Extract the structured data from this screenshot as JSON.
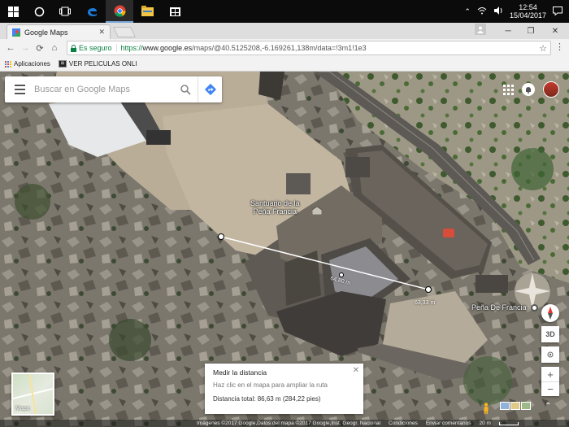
{
  "taskbar": {
    "icons": [
      "windows-start-icon",
      "search-icon",
      "task-view-icon",
      "edge-icon",
      "chrome-icon",
      "file-explorer-icon",
      "store-icon"
    ],
    "time": "12:54",
    "date": "15/04/2017"
  },
  "browser": {
    "tab_title": "Google Maps",
    "secure_label": "Es seguro",
    "url_prefix": "https://",
    "url_host": "www.google.es",
    "url_path": "/maps/@40.5125208,-6.169261,138m/data=!3m1!1e3",
    "bookmarks": [
      {
        "label": "Aplicaciones",
        "icon": "apps-icon"
      },
      {
        "label": "VER PELICULAS ONLI",
        "icon": "site-favicon"
      }
    ]
  },
  "maps": {
    "search_placeholder": "Buscar en Google Maps",
    "labels": {
      "sanctuary": "Santuario de la Peña Francia",
      "sanctuary_line1": "Santuario de la",
      "sanctuary_line2": "Peña Francia",
      "pena": "Peña De Francia"
    },
    "measure_labels": {
      "first": "64,80 m",
      "second": "63,33 m"
    },
    "measure_card": {
      "title": "Medir la distancia",
      "hint": "Haz clic en el mapa para ampliar la ruta",
      "total": "Distancia total: 86,63 m (284,22 pies)"
    },
    "minimap_label": "Mapa",
    "controls": {
      "tilt": "3D",
      "zoom_in": "+",
      "zoom_out": "−"
    },
    "footer": {
      "imagery": "Imágenes ©2017 Google,Datos del mapa ©2017 Google,Inst. Geogr. Nacional",
      "terms": "Condiciones",
      "feedback": "Enviar comentarios",
      "scale": "20 m"
    }
  }
}
